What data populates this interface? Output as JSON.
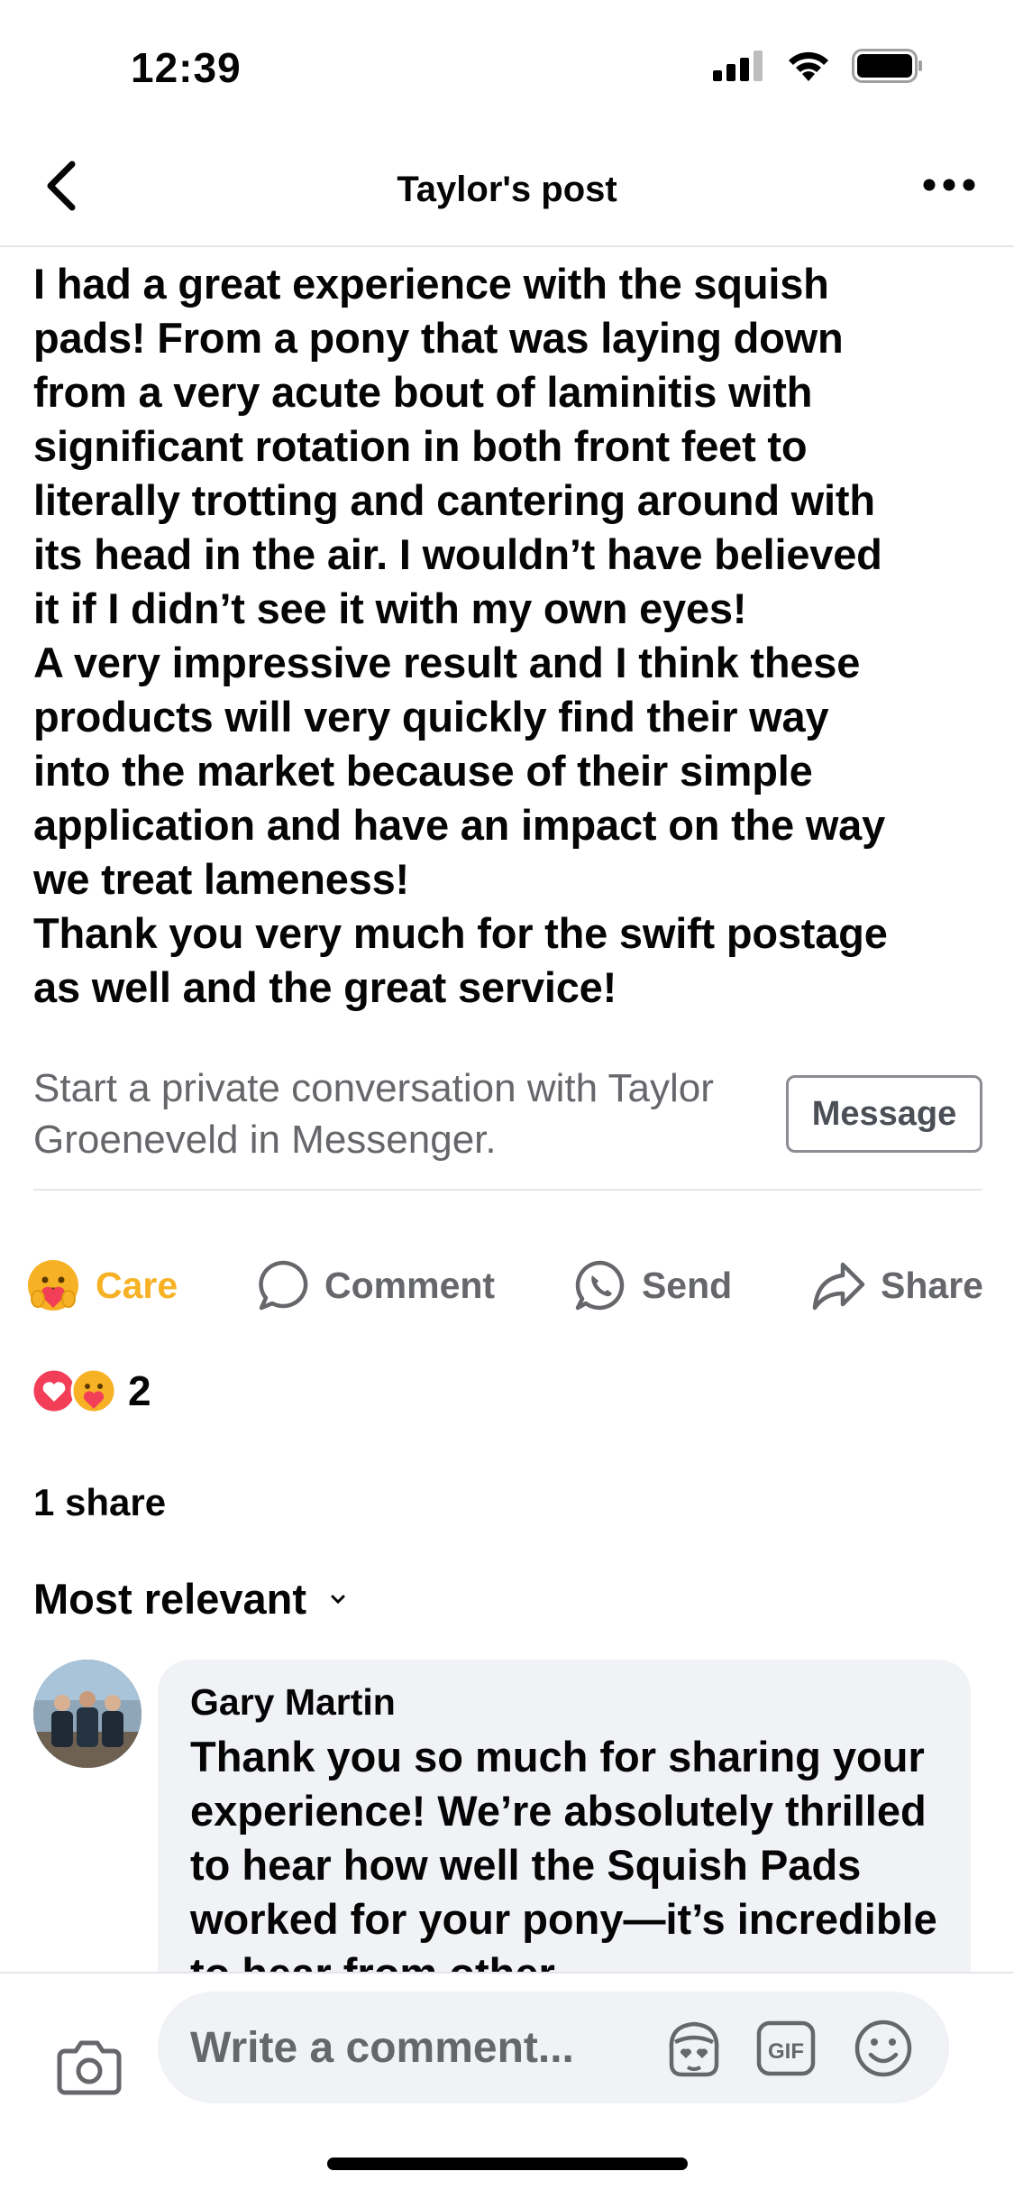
{
  "status_bar": {
    "time": "12:39"
  },
  "header": {
    "title": "Taylor's post"
  },
  "post": {
    "body": "I had a great experience with the squish\npads! From a pony that was laying down\nfrom a very acute bout of laminitis with\nsignificant rotation in both front feet to\nliterally trotting and cantering around with\nits head in the air. I wouldn’t have believed\nit if I didn’t see it with my own eyes!\nA very impressive result and I think these\nproducts will very quickly find their way\ninto the market because of their simple\napplication and have an impact on the way\nwe treat lameness!\nThank you very much for the swift postage\nas well and the great service!"
  },
  "private_conversation": {
    "text": "Start a private conversation with Taylor Groeneveld in Messenger.",
    "button_label": "Message"
  },
  "actions": {
    "care_label": "Care",
    "comment_label": "Comment",
    "send_label": "Send",
    "share_label": "Share"
  },
  "reactions": {
    "icons": [
      "love-reaction-icon",
      "care-reaction-icon"
    ],
    "count": "2"
  },
  "shares": {
    "label": "1 share"
  },
  "sort": {
    "label": "Most relevant"
  },
  "comments": [
    {
      "author": "Gary Martin",
      "text": "Thank you so much for sharing your experience! We’re absolutely thrilled to hear how well the Squish Pads worked for your pony—it’s incredible to hear from other"
    }
  ],
  "composer": {
    "placeholder": "Write a comment..."
  },
  "colors": {
    "care": "#f7b125",
    "secondary_text": "#65676b",
    "bubble": "#f0f2f5",
    "love": "#f33e58"
  }
}
